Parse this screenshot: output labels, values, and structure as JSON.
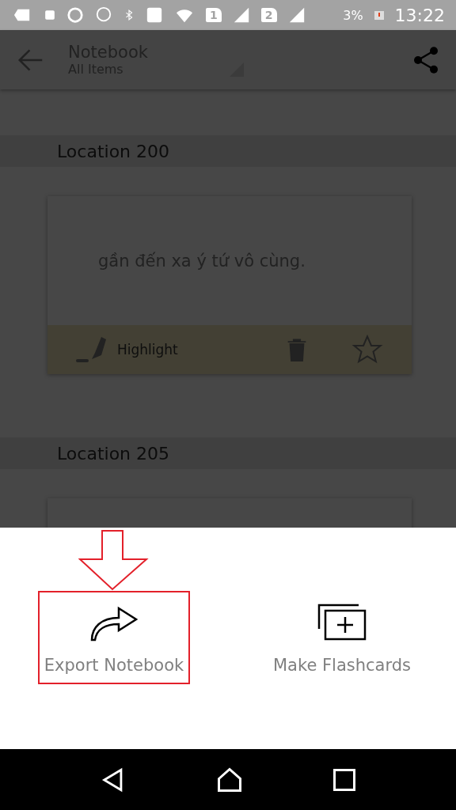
{
  "status_bar": {
    "sim_1": "1",
    "sim_2": "2",
    "battery": "3%",
    "time": "13:22"
  },
  "app_bar": {
    "title": "Notebook",
    "subtitle": "All Items"
  },
  "sections": [
    {
      "location": "Location 200",
      "note": "gần đến xa ý tứ vô cùng.",
      "highlight_label": "Highlight",
      "starred": false
    },
    {
      "location": "Location 205"
    }
  ],
  "sheet": {
    "actions": [
      {
        "kind": "export",
        "label": "Export Notebook",
        "highlighted": true
      },
      {
        "kind": "flashcards",
        "label": "Make Flashcards",
        "highlighted": false
      }
    ]
  }
}
